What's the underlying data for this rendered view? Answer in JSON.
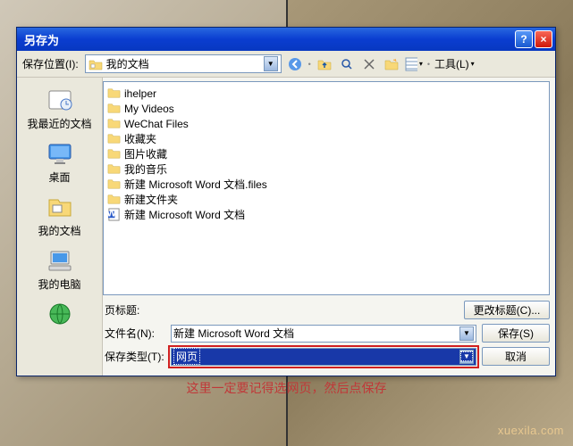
{
  "dialog": {
    "title": "另存为",
    "help_symbol": "?",
    "close_symbol": "×"
  },
  "toolbar": {
    "save_in_label": "保存位置(I):",
    "location_value": "我的文档",
    "tools_label": "工具(L)"
  },
  "places": [
    {
      "label": "我最近的文档",
      "type": "recent"
    },
    {
      "label": "桌面",
      "type": "desktop"
    },
    {
      "label": "我的文档",
      "type": "docs"
    },
    {
      "label": "我的电脑",
      "type": "computer"
    },
    {
      "label": "",
      "type": "network"
    }
  ],
  "files": [
    {
      "name": "ihelper",
      "type": "folder"
    },
    {
      "name": "My Videos",
      "type": "folder"
    },
    {
      "name": "WeChat Files",
      "type": "folder"
    },
    {
      "name": "收藏夹",
      "type": "folder"
    },
    {
      "name": "图片收藏",
      "type": "folder"
    },
    {
      "name": "我的音乐",
      "type": "folder"
    },
    {
      "name": "新建 Microsoft Word 文档.files",
      "type": "folder"
    },
    {
      "name": "新建文件夹",
      "type": "folder"
    },
    {
      "name": "新建 Microsoft Word 文档",
      "type": "word"
    }
  ],
  "bottom": {
    "page_title_label": "页标题:",
    "page_title_value": "",
    "change_title_btn": "更改标题(C)...",
    "filename_label": "文件名(N):",
    "filename_value": "新建 Microsoft Word 文档",
    "filetype_label": "保存类型(T):",
    "filetype_value": "网页",
    "save_btn": "保存(S)",
    "cancel_btn": "取消"
  },
  "caption": "这里一定要记得选网页，然后点保存",
  "watermark": "xuexila.com"
}
